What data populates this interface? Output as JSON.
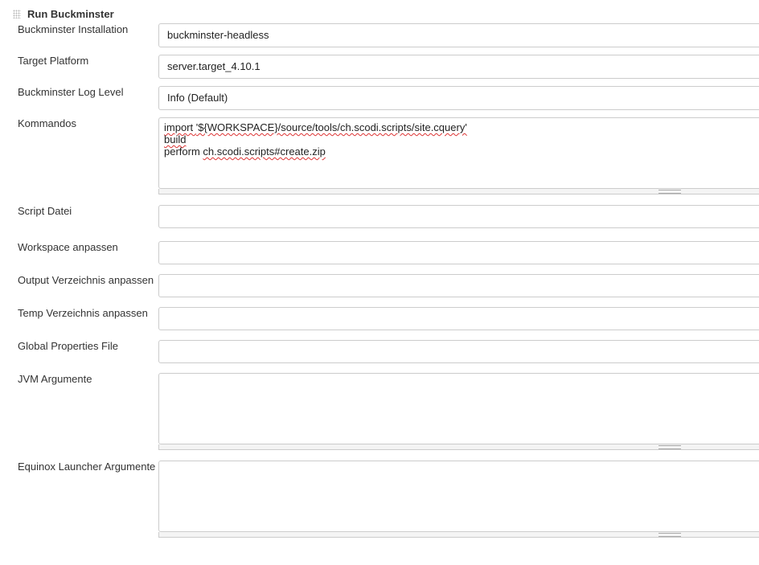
{
  "section": {
    "title": "Run Buckminster",
    "handle_icon": "drag-handle-icon"
  },
  "fields": {
    "installation": {
      "label": "Buckminster Installation",
      "value": "buckminster-headless"
    },
    "target_platform": {
      "label": "Target Platform",
      "value": "server.target_4.10.1"
    },
    "log_level": {
      "label": "Buckminster Log Level",
      "value": "Info (Default)"
    },
    "kommandos": {
      "label": "Kommandos",
      "line1_a": "import ",
      "line1_b": "'${WORKSPACE}/source/tools/ch.scodi.scripts/site.cquery'",
      "line2": "build",
      "line3_a": "perform ",
      "line3_b": "ch.scodi.scripts#create.zip"
    },
    "script_datei": {
      "label": "Script Datei",
      "value": ""
    },
    "workspace": {
      "label": "Workspace anpassen",
      "value": ""
    },
    "output_dir": {
      "label": "Output Verzeichnis anpassen",
      "value": ""
    },
    "temp_dir": {
      "label": "Temp Verzeichnis anpassen",
      "value": ""
    },
    "global_props": {
      "label": "Global Properties File",
      "value": ""
    },
    "jvm_args": {
      "label": "JVM Argumente",
      "value": ""
    },
    "equinox_args": {
      "label": "Equinox Launcher Argumente",
      "value": ""
    }
  }
}
